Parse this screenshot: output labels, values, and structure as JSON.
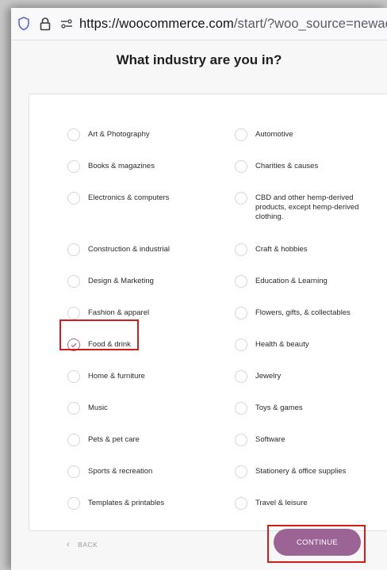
{
  "browser": {
    "url_host": "https://woocommerce.com",
    "url_path": "/start/?woo_source=newacc"
  },
  "page": {
    "heading": "What industry are you in?"
  },
  "industries": {
    "left": [
      "Art & Photography",
      "Books & magazines",
      "Electronics & computers",
      "Construction & industrial",
      "Design & Marketing",
      "Fashion & apparel",
      "Food & drink",
      "Home & furniture",
      "Music",
      "Pets & pet care",
      "Sports & recreation",
      "Templates & printables"
    ],
    "right": [
      "Automotive",
      "Charities & causes",
      "CBD and other hemp-derived products, except hemp-derived clothing.",
      "Craft & hobbies",
      "Education & Learning",
      "Flowers, gifts, & collectables",
      "Health & beauty",
      "Jewelry",
      "Toys & games",
      "Software",
      "Stationery & office supplies",
      "Travel & leisure"
    ],
    "selected": "Food & drink"
  },
  "footer": {
    "back_label": "BACK",
    "continue_label": "CONTINUE"
  },
  "colors": {
    "accent": "#9c6495",
    "highlight": "#d01e1e"
  }
}
